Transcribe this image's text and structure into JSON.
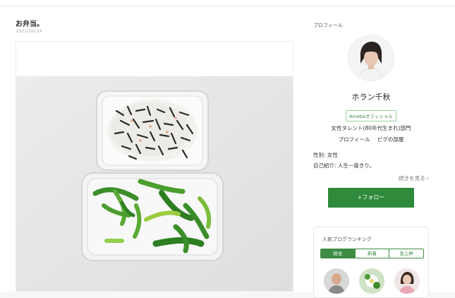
{
  "article": {
    "title": "お弁当。",
    "date": "2021/09/24"
  },
  "sidebar": {
    "profile_heading": "プロフィール",
    "name": "ホラン千秋",
    "badge": "Amebaオフィシャル",
    "category": "女性タレント(80年代生まれ)部門",
    "links": [
      "プロフィール",
      "ピグの部屋"
    ],
    "gender": "性別: 女性",
    "intro": "自己紹介: 人生一度きり。",
    "more": "続きを見る ›",
    "follow": "+フォロー"
  },
  "ranking": {
    "title": "人気ブログランキング",
    "tabs": [
      "総合",
      "新着",
      "急上昇"
    ],
    "active_tab": "総合"
  },
  "colors": {
    "accent": "#2f8a3b",
    "badge_border": "#9ccf9f"
  }
}
